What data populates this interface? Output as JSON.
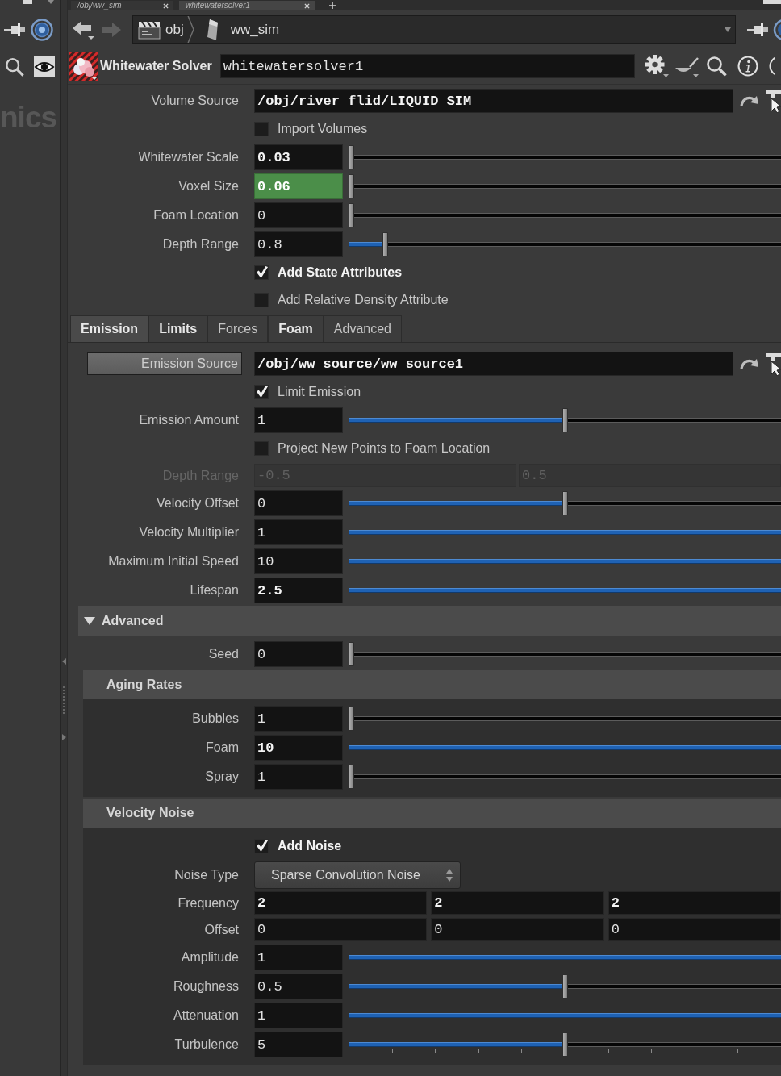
{
  "pane_tabs": [
    {
      "label": "/obj/ww_sim",
      "selected": false
    },
    {
      "label": "whitewatersolver1",
      "selected": true
    }
  ],
  "left_pane": {
    "heading_fragment": "nics"
  },
  "history": {
    "can_go_back": true,
    "can_go_forward": false
  },
  "path_bar": {
    "segments": [
      {
        "label": "obj",
        "kind": "context"
      },
      {
        "label": "ww_sim",
        "kind": "node"
      }
    ]
  },
  "node": {
    "type_label": "Whitewater Solver",
    "name": "whitewatersolver1"
  },
  "parameters": [
    {
      "kind": "path",
      "label": "Volume Source",
      "value": "/obj/river_flid/LIQUID_SIM",
      "modified": true
    },
    {
      "kind": "checkbox",
      "label": "Import Volumes",
      "checked": false,
      "modified": false
    },
    {
      "kind": "slider",
      "label": "Whitewater Scale",
      "value": "0.03",
      "modified": true,
      "highlighted": false,
      "level": 0
    },
    {
      "kind": "slider",
      "label": "Voxel Size",
      "value": "0.06",
      "modified": true,
      "highlighted": true,
      "level": 0
    },
    {
      "kind": "slider",
      "label": "Foam Location",
      "value": "0",
      "modified": false,
      "highlighted": false,
      "level": 0
    },
    {
      "kind": "slider",
      "label": "Depth Range",
      "value": "0.8",
      "modified": false,
      "highlighted": false,
      "level": 0.08
    },
    {
      "kind": "checkbox",
      "label": "Add State Attributes",
      "checked": true,
      "modified": true
    },
    {
      "kind": "checkbox",
      "label": "Add Relative Density Attribute",
      "checked": false,
      "modified": false
    }
  ],
  "tabs": [
    {
      "label": "Emission",
      "selected": true,
      "modified": true
    },
    {
      "label": "Limits",
      "selected": false,
      "modified": true
    },
    {
      "label": "Forces",
      "selected": false,
      "modified": false
    },
    {
      "label": "Foam",
      "selected": false,
      "modified": true
    },
    {
      "label": "Advanced",
      "selected": false,
      "modified": false
    }
  ],
  "tab_parameters": [
    {
      "kind": "path_button",
      "label": "Emission Source",
      "value": "/obj/ww_source/ww_source1",
      "modified": true
    },
    {
      "kind": "checkbox",
      "label": "Limit Emission",
      "checked": true,
      "modified": false
    },
    {
      "kind": "slider",
      "label": "Emission Amount",
      "value": "1",
      "modified": false,
      "highlighted": false,
      "level": 0.5
    },
    {
      "kind": "checkbox",
      "label": "Project New Points to Foam Location",
      "checked": false,
      "modified": false
    },
    {
      "kind": "range",
      "label": "Depth Range",
      "values": [
        "-0.5",
        "0.5"
      ],
      "disabled": true
    },
    {
      "kind": "slider",
      "label": "Velocity Offset",
      "value": "0",
      "modified": false,
      "highlighted": false,
      "level": 0.5
    },
    {
      "kind": "slider",
      "label": "Velocity Multiplier",
      "value": "1",
      "modified": false,
      "highlighted": false,
      "level": 1
    },
    {
      "kind": "slider",
      "label": "Maximum Initial Speed",
      "value": "10",
      "modified": false,
      "highlighted": false,
      "level": 1
    },
    {
      "kind": "slider",
      "label": "Lifespan",
      "value": "2.5",
      "modified": true,
      "highlighted": false,
      "level": 1
    }
  ],
  "sections": [
    {
      "title": "Advanced",
      "expanded": true,
      "parameters": [
        {
          "kind": "slider",
          "label": "Seed",
          "value": "0",
          "modified": false,
          "highlighted": false,
          "level": 0
        }
      ],
      "folders": [
        {
          "title": "Aging Rates",
          "parameters": [
            {
              "kind": "slider",
              "label": "Bubbles",
              "value": "1",
              "modified": false,
              "highlighted": false,
              "level": 0
            },
            {
              "kind": "slider",
              "label": "Foam",
              "value": "10",
              "modified": true,
              "highlighted": false,
              "level": 1
            },
            {
              "kind": "slider",
              "label": "Spray",
              "value": "1",
              "modified": false,
              "highlighted": false,
              "level": 0
            }
          ]
        },
        {
          "title": "Velocity Noise",
          "parameters": [
            {
              "kind": "checkbox",
              "label": "Add Noise",
              "checked": true,
              "modified": true
            },
            {
              "kind": "menu",
              "label": "Noise Type",
              "value": "Sparse Convolution Noise"
            },
            {
              "kind": "vector",
              "label": "Frequency",
              "values": [
                "2",
                "2",
                "2"
              ],
              "modified": true
            },
            {
              "kind": "vector",
              "label": "Offset",
              "values": [
                "0",
                "0",
                "0"
              ],
              "modified": false
            },
            {
              "kind": "slider",
              "label": "Amplitude",
              "value": "1",
              "modified": false,
              "highlighted": false,
              "level": 1
            },
            {
              "kind": "slider",
              "label": "Roughness",
              "value": "0.5",
              "modified": false,
              "highlighted": false,
              "level": 0.5
            },
            {
              "kind": "slider",
              "label": "Attenuation",
              "value": "1",
              "modified": false,
              "highlighted": false,
              "level": 1
            },
            {
              "kind": "stepped_slider",
              "label": "Turbulence",
              "value": "5",
              "modified": false,
              "highlighted": false,
              "level": 0.5
            }
          ]
        }
      ]
    }
  ]
}
